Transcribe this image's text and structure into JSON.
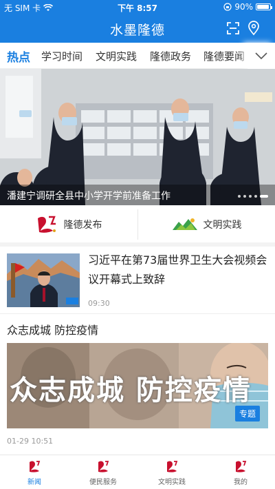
{
  "status_bar": {
    "carrier": "无 SIM 卡",
    "time": "下午 8:57",
    "battery": "90%"
  },
  "header": {
    "title": "水墨隆德",
    "icons": [
      "scan-icon",
      "location-pin-icon"
    ]
  },
  "tabs": [
    {
      "label": "热点",
      "active": true
    },
    {
      "label": "学习时间"
    },
    {
      "label": "文明实践"
    },
    {
      "label": "隆德政务"
    },
    {
      "label": "隆德要闻"
    }
  ],
  "banner": {
    "caption": "潘建宁调研全县中小学开学前准备工作",
    "slide_count": 5,
    "current_slide": 5
  },
  "quick_links": [
    {
      "label": "隆德发布",
      "icon": "longde-logo-icon"
    },
    {
      "label": "文明实践",
      "icon": "mountain-logo-icon"
    }
  ],
  "news_items": [
    {
      "title": "习近平在第73届世界卫生大会视频会议开幕式上致辞",
      "time": "09:30"
    }
  ],
  "topic": {
    "heading": "众志成城 防控疫情",
    "image_text": "众志成城  防控疫情",
    "badge": "专题",
    "time": "01-29 10:51"
  },
  "tab_bar": [
    {
      "label": "新闻",
      "active": true
    },
    {
      "label": "便民服务"
    },
    {
      "label": "文明实践"
    },
    {
      "label": "我的"
    }
  ],
  "colors": {
    "primary": "#1a7fe0",
    "brand_red": "#c8102e"
  }
}
